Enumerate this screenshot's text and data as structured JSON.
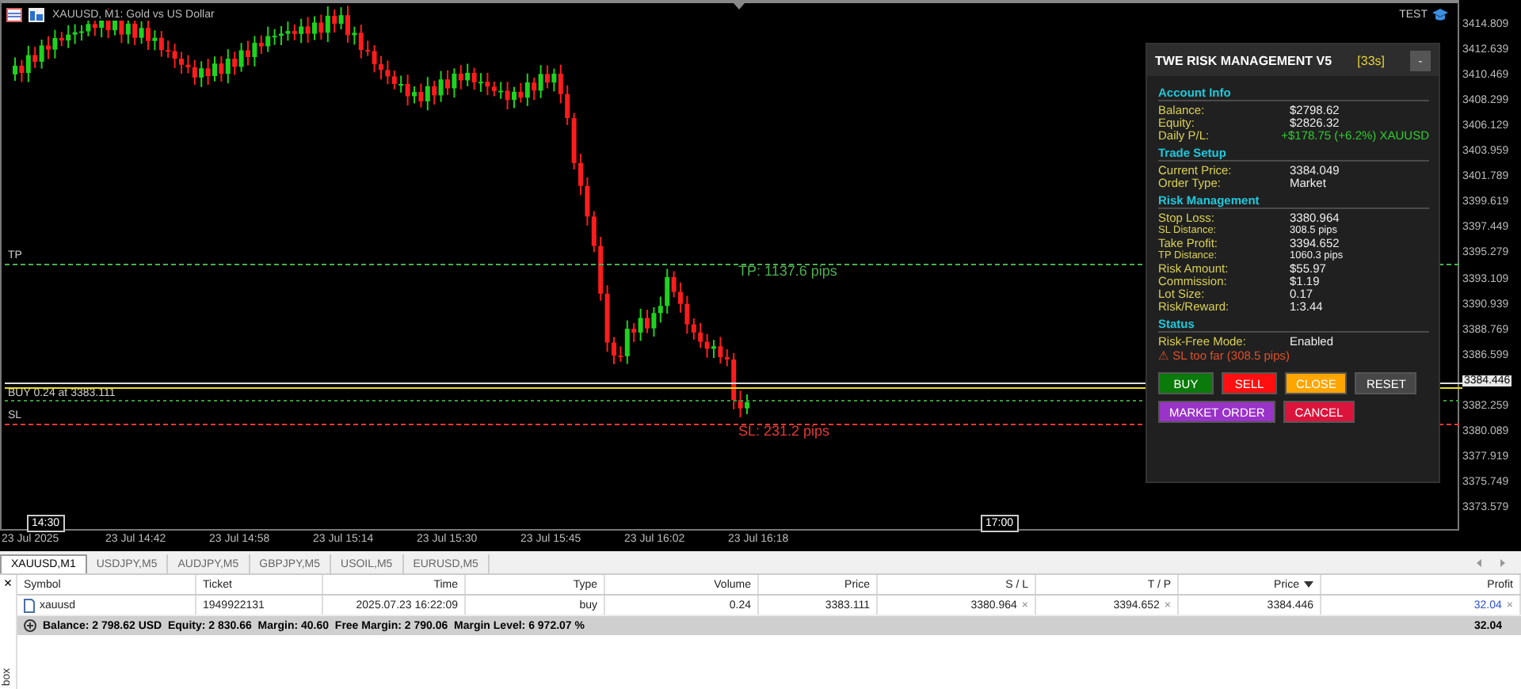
{
  "chart": {
    "title": "XAUUSD, M1:  Gold vs US Dollar",
    "account": "TEST",
    "price_ticks": [
      {
        "label": "3414.809",
        "current": false
      },
      {
        "label": "3412.639",
        "current": false
      },
      {
        "label": "3410.469",
        "current": false
      },
      {
        "label": "3408.299",
        "current": false
      },
      {
        "label": "3406.129",
        "current": false
      },
      {
        "label": "3403.959",
        "current": false
      },
      {
        "label": "3401.789",
        "current": false
      },
      {
        "label": "3399.619",
        "current": false
      },
      {
        "label": "3397.449",
        "current": false
      },
      {
        "label": "3395.279",
        "current": false
      },
      {
        "label": "3393.109",
        "current": false
      },
      {
        "label": "3390.939",
        "current": false
      },
      {
        "label": "3388.769",
        "current": false
      },
      {
        "label": "3386.599",
        "current": false
      },
      {
        "label": "3384.446",
        "current": true
      },
      {
        "label": "3382.259",
        "current": false
      },
      {
        "label": "3380.089",
        "current": false
      },
      {
        "label": "3377.919",
        "current": false
      },
      {
        "label": "3375.749",
        "current": false
      },
      {
        "label": "3373.579",
        "current": false
      }
    ],
    "time_labels": [
      "23 Jul 2025",
      "23 Jul 14:42",
      "23 Jul 14:58",
      "23 Jul 15:14",
      "23 Jul 15:30",
      "23 Jul 15:45",
      "23 Jul 16:02",
      "23 Jul 16:18"
    ],
    "session_markers": [
      {
        "label": "14:30",
        "kind": "start"
      },
      {
        "label": "17:00",
        "kind": "end"
      }
    ],
    "levels": [
      {
        "kind": "tp",
        "label": "TP",
        "note": "TP: 1137.6 pips"
      },
      {
        "kind": "entry",
        "label": "BUY 0.24 at 3383.111"
      },
      {
        "kind": "sl",
        "label": "SL",
        "note": "SL: 231.2 pips"
      }
    ]
  },
  "panel": {
    "title": "TWE RISK MANAGEMENT V5",
    "timer": "[33s]",
    "minimize": "-",
    "sections": [
      {
        "title": "Account Info",
        "rows": [
          {
            "label": "Balance:",
            "value": "$2798.62",
            "kind": "normal"
          },
          {
            "label": "Equity:",
            "value": "$2826.32",
            "kind": "normal"
          },
          {
            "label": "Daily P/L:",
            "value": "+$178.75 (+6.2%) XAUUSD",
            "kind": "profit"
          }
        ]
      },
      {
        "title": "Trade Setup",
        "rows": [
          {
            "label": "Current Price:",
            "value": "3384.049",
            "kind": "normal"
          },
          {
            "label": "Order Type:",
            "value": "Market",
            "kind": "normal"
          }
        ]
      },
      {
        "title": "Risk Management",
        "rows": [
          {
            "label": "Stop Loss:",
            "value": "3380.964",
            "kind": "normal"
          },
          {
            "label": "SL Distance:",
            "value": "308.5 pips",
            "kind": "small"
          },
          {
            "label": "Take Profit:",
            "value": "3394.652",
            "kind": "normal"
          },
          {
            "label": "TP Distance:",
            "value": "1060.3 pips",
            "kind": "small"
          },
          {
            "label": "Risk Amount:",
            "value": "$55.97",
            "kind": "normal"
          },
          {
            "label": "Commission:",
            "value": "$1.19",
            "kind": "normal"
          },
          {
            "label": "Lot Size:",
            "value": "0.17",
            "kind": "normal"
          },
          {
            "label": "Risk/Reward:",
            "value": "1:3.44",
            "kind": "normal"
          }
        ]
      },
      {
        "title": "Status",
        "rows": [
          {
            "label": "Risk-Free Mode:",
            "value": "Enabled",
            "kind": "normal"
          }
        ]
      }
    ],
    "warning": "⚠ SL too far (308.5 pips)",
    "buttons": [
      [
        {
          "label": "BUY",
          "color": "#0a7a0a"
        },
        {
          "label": "SELL",
          "color": "#ff1010"
        },
        {
          "label": "CLOSE",
          "color": "#ffa500"
        },
        {
          "label": "RESET",
          "color": "#474747"
        }
      ],
      [
        {
          "label": "MARKET ORDER",
          "color": "#9a33c8"
        },
        {
          "label": "CANCEL",
          "color": "#dc143c"
        }
      ]
    ]
  },
  "tabs": [
    {
      "label": "XAUUSD,M1",
      "selected": true
    },
    {
      "label": "USDJPY,M5",
      "selected": false
    },
    {
      "label": "AUDJPY,M5",
      "selected": false
    },
    {
      "label": "GBPJPY,M5",
      "selected": false
    },
    {
      "label": "USOIL,M5",
      "selected": false
    },
    {
      "label": "EURUSD,M5",
      "selected": false
    }
  ],
  "table": {
    "close": "×",
    "columns": [
      {
        "label": "Symbol",
        "sorted": false
      },
      {
        "label": "Ticket",
        "sorted": false
      },
      {
        "label": "Time",
        "sorted": false
      },
      {
        "label": "Type",
        "sorted": false
      },
      {
        "label": "Volume",
        "sorted": false
      },
      {
        "label": "Price",
        "sorted": false
      },
      {
        "label": "S / L",
        "sorted": false
      },
      {
        "label": "T / P",
        "sorted": false
      },
      {
        "label": "Price",
        "sorted": true
      },
      {
        "label": "Profit",
        "sorted": false
      }
    ],
    "rows": [
      {
        "cells": [
          "xauusd",
          "1949922131",
          "2025.07.23 16:22:09",
          "buy",
          "0.24",
          "3383.111",
          "3380.964",
          "3394.652",
          "3384.446",
          "32.04"
        ],
        "removable": [
          false,
          false,
          false,
          false,
          false,
          false,
          true,
          true,
          false,
          true
        ]
      }
    ],
    "summary": {
      "text": "Balance: 2 798.62 USD  Equity: 2 830.66  Margin: 40.60  Free Margin: 2 790.06  Margin Level: 6 972.07 %",
      "profit": "32.04"
    }
  },
  "side_label": "box"
}
